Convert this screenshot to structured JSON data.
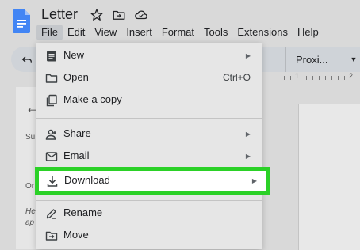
{
  "document": {
    "title": "Letter"
  },
  "menubar": {
    "items": [
      "File",
      "Edit",
      "View",
      "Insert",
      "Format",
      "Tools",
      "Extensions",
      "Help"
    ],
    "active": "File"
  },
  "toolbar": {
    "font_name": "Proxi..."
  },
  "ruler": {
    "labels": [
      "1",
      "2"
    ]
  },
  "side_panel": {
    "fragments": [
      "Su",
      "Or",
      "He",
      "ap"
    ]
  },
  "file_menu": {
    "items": [
      {
        "label": "New",
        "icon": "new-document-icon",
        "submenu": true
      },
      {
        "label": "Open",
        "icon": "folder-icon",
        "shortcut": "Ctrl+O"
      },
      {
        "label": "Make a copy",
        "icon": "copy-icon"
      },
      {
        "label": "Share",
        "icon": "share-person-icon",
        "submenu": true
      },
      {
        "label": "Email",
        "icon": "email-icon",
        "submenu": true
      },
      {
        "label": "Download",
        "icon": "download-icon",
        "submenu": true,
        "highlighted": true
      },
      {
        "label": "Rename",
        "icon": "rename-icon"
      },
      {
        "label": "Move",
        "icon": "move-folder-icon"
      }
    ],
    "highlight_color": "#2bd127"
  },
  "colors": {
    "brand_blue": "#4285f4",
    "highlight_green": "#2bd127"
  }
}
